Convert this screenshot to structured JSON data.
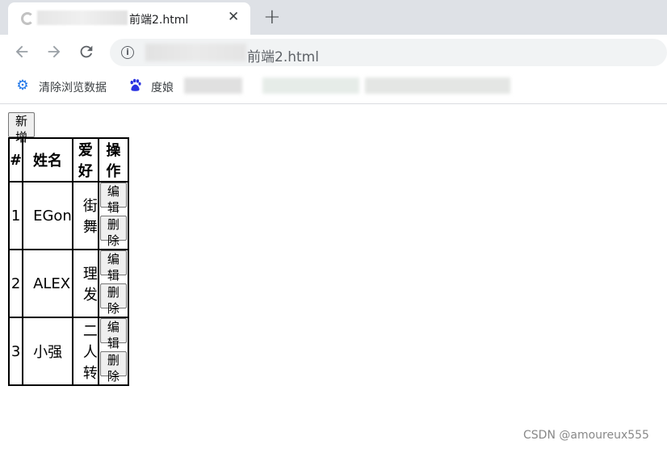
{
  "browser": {
    "tab_title": "前端2.html",
    "tab_close_glyph": "✕",
    "new_tab_glyph": "+",
    "url_text": "前端2.html",
    "bookmarks": [
      {
        "label": "清除浏览数据",
        "icon": "gear-icon"
      },
      {
        "label": "度娘",
        "icon": "baidu-paw-icon"
      }
    ]
  },
  "page": {
    "add_button": "新增",
    "table": {
      "headers": [
        "#",
        "姓名",
        "爱好",
        "操作"
      ],
      "rows": [
        {
          "num": "1",
          "name": "EGon",
          "hobby": "街舞"
        },
        {
          "num": "2",
          "name": "ALEX",
          "hobby": "理发"
        },
        {
          "num": "3",
          "name": "小强",
          "hobby": "二人转"
        }
      ],
      "edit_label": "编辑",
      "delete_label": "删除"
    }
  },
  "watermark": "CSDN @amoureux555",
  "colors": {
    "tab_strip": "#dee1e6",
    "accent_blue": "#1a73e8",
    "baidu_blue": "#2932e1"
  }
}
